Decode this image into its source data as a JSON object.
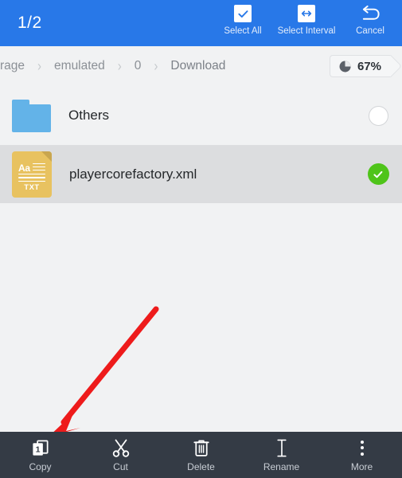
{
  "topbar": {
    "counter": "1/2",
    "actions": [
      {
        "label": "Select All",
        "icon": "check-square-icon"
      },
      {
        "label": "Select Interval",
        "icon": "interval-arrows-icon"
      },
      {
        "label": "Cancel",
        "icon": "undo-arrow-icon"
      }
    ],
    "background_color": "#2878e8"
  },
  "breadcrumb": {
    "items": [
      "rage",
      "emulated",
      "0",
      "Download"
    ],
    "separator": "›",
    "storage": {
      "percent_label": "67%",
      "icon": "pie-chart-icon"
    }
  },
  "files": {
    "rows": [
      {
        "name": "Others",
        "icon": "folder-icon",
        "type": "folder",
        "selected": false,
        "checkbox_state": "unchecked"
      },
      {
        "name": "playercorefactory.xml",
        "icon": "txt-file-icon",
        "icon_badge": "TXT",
        "icon_glyph_text": "Aa",
        "type": "file",
        "selected": true,
        "checkbox_state": "checked"
      }
    ]
  },
  "annotation": {
    "type": "arrow",
    "color": "#ee1b1b",
    "points_to": "copy-button"
  },
  "bottombar": {
    "background_color": "#343b45",
    "buttons": [
      {
        "label": "Copy",
        "icon": "copy-pages-icon",
        "badge": "1"
      },
      {
        "label": "Cut",
        "icon": "scissors-icon"
      },
      {
        "label": "Delete",
        "icon": "trash-icon"
      },
      {
        "label": "Rename",
        "icon": "text-cursor-icon"
      },
      {
        "label": "More",
        "icon": "vertical-dots-icon"
      }
    ]
  }
}
